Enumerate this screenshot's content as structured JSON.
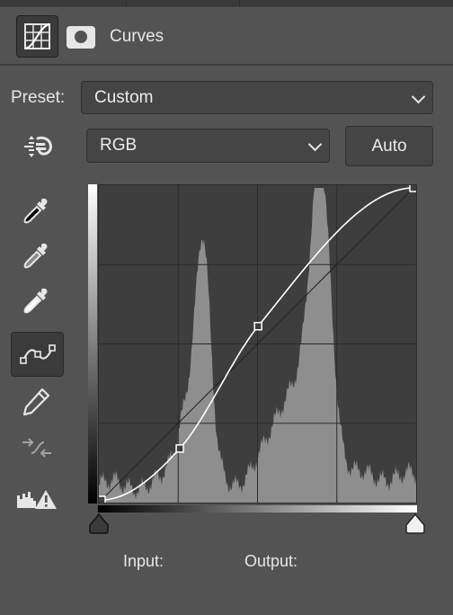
{
  "panel": {
    "title": "Curves",
    "icons": {
      "curves_tab": "curves-adjustment-icon",
      "mask_tab": "layer-mask-icon"
    }
  },
  "preset": {
    "label": "Preset:",
    "value": "Custom"
  },
  "channel": {
    "value": "RGB"
  },
  "auto_button": {
    "label": "Auto"
  },
  "tools": [
    {
      "name": "on-image-adjust-tool",
      "icon": "target-adjust-icon",
      "active": false
    },
    {
      "name": "black-point-eyedropper",
      "icon": "eyedropper-black-icon",
      "active": false
    },
    {
      "name": "gray-point-eyedropper",
      "icon": "eyedropper-gray-icon",
      "active": false
    },
    {
      "name": "white-point-eyedropper",
      "icon": "eyedropper-white-icon",
      "active": false
    },
    {
      "name": "curve-point-tool",
      "icon": "curve-edit-icon",
      "active": true
    },
    {
      "name": "pencil-draw-tool",
      "icon": "pencil-icon",
      "active": false
    },
    {
      "name": "smooth-curve-tool",
      "icon": "smooth-icon",
      "active": false
    },
    {
      "name": "clipping-warning-toggle",
      "icon": "clipping-warning-icon",
      "active": false
    }
  ],
  "curve": {
    "points": [
      [
        0,
        0
      ],
      [
        64,
        42
      ],
      [
        128,
        142
      ],
      [
        255,
        255
      ]
    ],
    "histogram_color": "#8e8e8e",
    "curve_color": "#ffffff"
  },
  "readout": {
    "input_label": "Input:",
    "output_label": "Output:"
  },
  "colors": {
    "panel_bg": "#535353",
    "graph_bg": "#3e3e3e",
    "control_bg": "#454545",
    "text": "#e6e6e6"
  }
}
